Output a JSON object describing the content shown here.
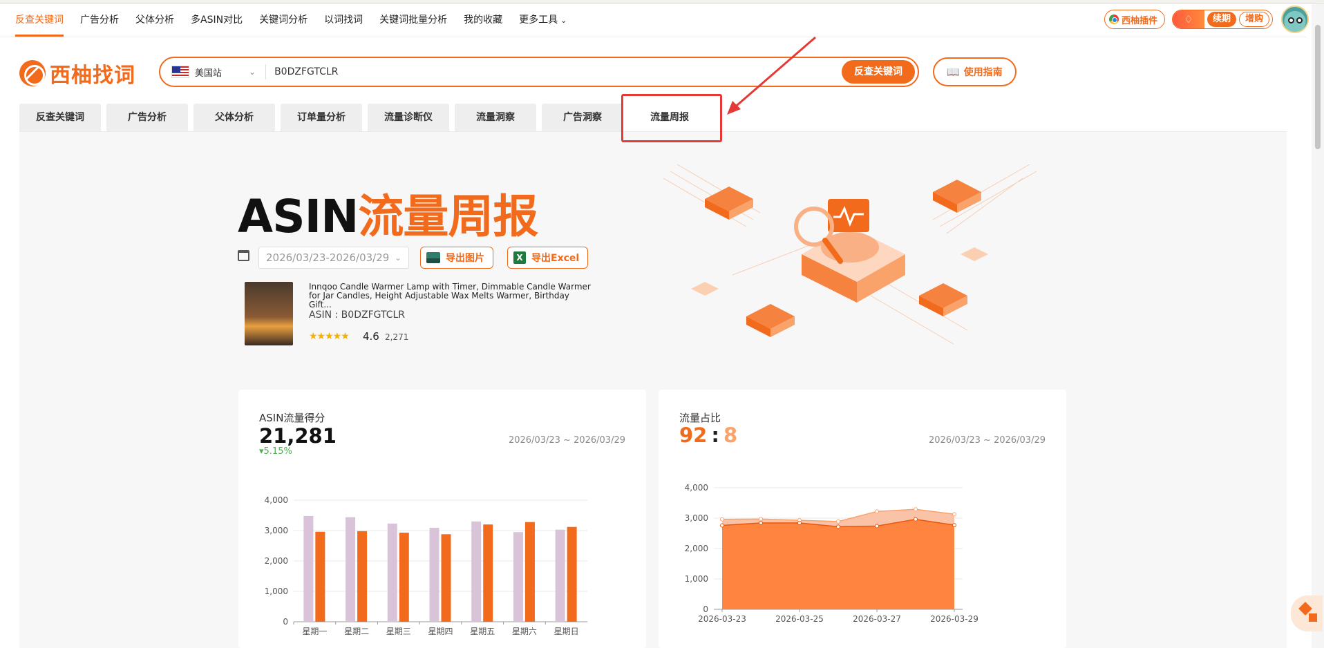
{
  "topnav": {
    "items": [
      "反查关键词",
      "广告分析",
      "父体分析",
      "多ASIN对比",
      "关键词分析",
      "以词找词",
      "关键词批量分析",
      "我的收藏",
      "更多工具"
    ],
    "plugin_label": "西柚插件",
    "renew_label": "续期",
    "buy_label": "增购"
  },
  "logo": {
    "text": "西柚找词"
  },
  "search": {
    "site": "美国站",
    "value": "B0DZFGTCLR",
    "button": "反查关键词",
    "guide": "使用指南"
  },
  "subtabs": [
    "反查关键词",
    "广告分析",
    "父体分析",
    "订单量分析",
    "流量诊断仪",
    "流量洞察",
    "广告洞察",
    "流量周报"
  ],
  "hero": {
    "title_black": "ASIN",
    "title_orange": "流量周报",
    "date_range": "2026/03/23-2026/03/29",
    "export_image": "导出图片",
    "export_excel": "导出Excel",
    "excel_letter": "X"
  },
  "product": {
    "title": "Innqoo Candle Warmer Lamp with Timer, Dimmable Candle Warmer for Jar Candles, Height Adjustable Wax Melts Warmer, Birthday Gift...",
    "asin": "ASIN : B0DZFGTCLR",
    "stars": "★★★★★",
    "rating": "4.6",
    "reviews": "2,271"
  },
  "card1": {
    "label": "ASIN流量得分",
    "value": "21,281",
    "change": "▾5.15%",
    "range": "2026/03/23 ~ 2026/03/29"
  },
  "card2": {
    "label": "流量占比",
    "ratio_a": "92",
    "ratio_sep": ":",
    "ratio_b": "8",
    "range": "2026/03/23 ~ 2026/03/29"
  },
  "colors": {
    "accent": "#f26a1b",
    "bar_prev": "#d9c3d8",
    "area_light": "#f9b998"
  },
  "chart_data": [
    {
      "type": "bar",
      "categories": [
        "星期一",
        "星期二",
        "星期三",
        "星期四",
        "星期五",
        "星期六",
        "星期日"
      ],
      "series": [
        {
          "values": [
            3480,
            3440,
            3230,
            3090,
            3300,
            2950,
            3030
          ]
        },
        {
          "values": [
            2960,
            2980,
            2930,
            2880,
            3200,
            3280,
            3120
          ]
        }
      ],
      "yticks": [
        "0",
        "1,000",
        "2,000",
        "3,000",
        "4,000"
      ],
      "ylim": [
        0,
        4000
      ],
      "grid": true
    },
    {
      "type": "area",
      "x": [
        "2026-03-23",
        "2026-03-24",
        "2026-03-25",
        "2026-03-26",
        "2026-03-27",
        "2026-03-28",
        "2026-03-29"
      ],
      "xticks": [
        "2026-03-23",
        "2026-03-25",
        "2026-03-27",
        "2026-03-29"
      ],
      "series": [
        {
          "values": [
            2760,
            2840,
            2840,
            2720,
            2740,
            2960,
            2770
          ]
        },
        {
          "values": [
            2960,
            2970,
            2930,
            2890,
            3220,
            3290,
            3130
          ]
        }
      ],
      "yticks": [
        "0",
        "1,000",
        "2,000",
        "3,000",
        "4,000"
      ],
      "ylim": [
        0,
        4000
      ],
      "grid": true
    }
  ]
}
